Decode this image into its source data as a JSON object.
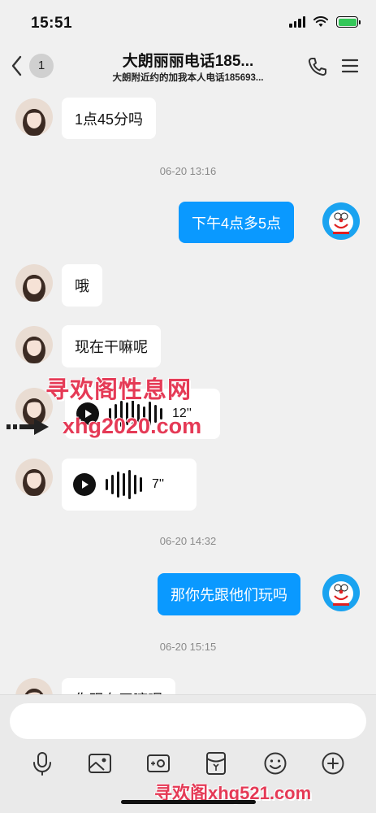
{
  "status": {
    "time": "15:51"
  },
  "header": {
    "unread_count": "1",
    "title": "大朗丽丽电话185...",
    "subtitle": "大朗附近约的加我本人电话185693..."
  },
  "messages": [
    {
      "type": "text",
      "direction": "in",
      "text": "1点45分吗"
    },
    {
      "type": "timestamp",
      "text": "06-20 13:16"
    },
    {
      "type": "text",
      "direction": "out",
      "text": "下午4点多5点"
    },
    {
      "type": "text",
      "direction": "in",
      "text": "哦"
    },
    {
      "type": "text",
      "direction": "in",
      "text": "现在干嘛呢"
    },
    {
      "type": "voice",
      "direction": "in",
      "duration": "12''"
    },
    {
      "type": "voice",
      "direction": "in",
      "duration": "7''"
    },
    {
      "type": "timestamp",
      "text": "06-20 14:32"
    },
    {
      "type": "text",
      "direction": "out",
      "text": "那你先跟他们玩吗"
    },
    {
      "type": "timestamp",
      "text": "06-20 15:15"
    },
    {
      "type": "text",
      "direction": "in",
      "text": "你现在干嘛呢"
    }
  ],
  "watermarks": {
    "top": "寻欢阁性息网",
    "middle": "xhg2020.com",
    "bottom": "寻欢阁xhg521.com"
  },
  "input": {
    "placeholder": ""
  },
  "toolbar": [
    "mic-icon",
    "image-icon",
    "camera-icon",
    "red-packet-icon",
    "emoji-icon",
    "plus-icon"
  ],
  "colors": {
    "outgoing_bubble": "#0a99ff",
    "incoming_bubble": "#ffffff",
    "background": "#f0f0f0"
  }
}
